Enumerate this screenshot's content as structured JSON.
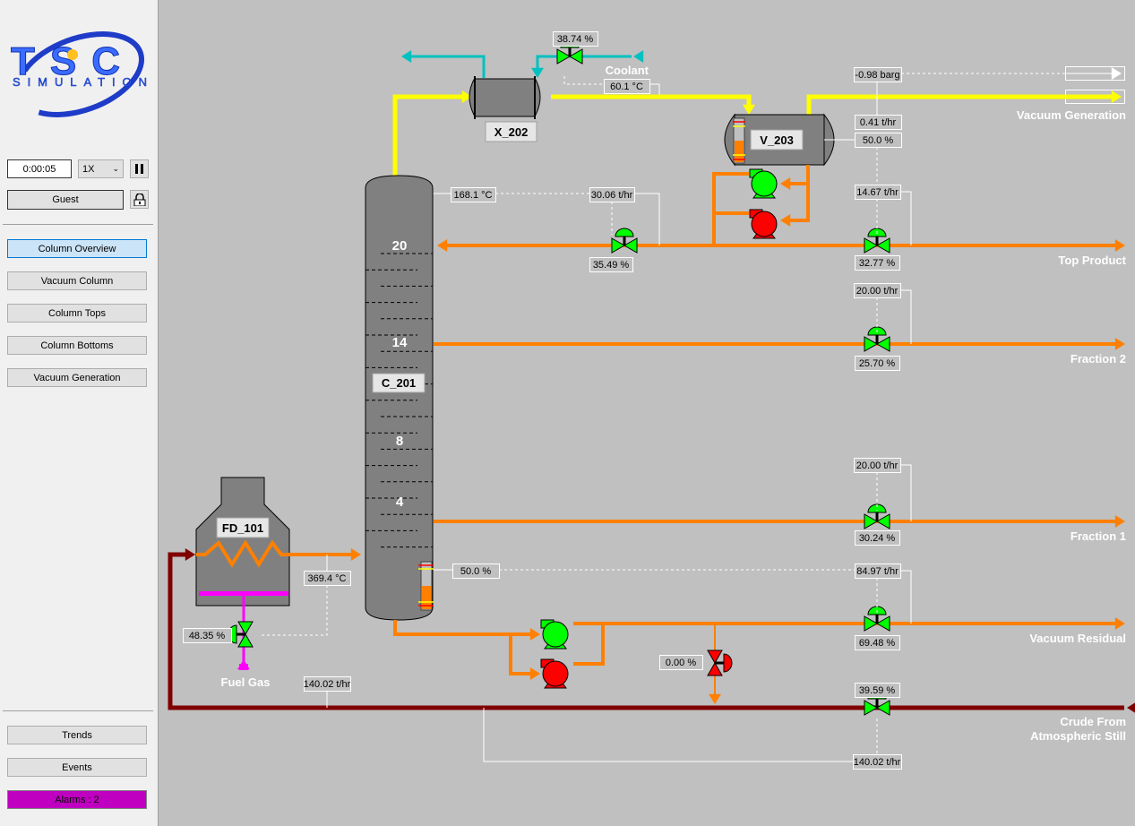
{
  "sidebar": {
    "logo_text": "TSC SIMULATION",
    "sim_time": "0:00:05",
    "speed": "1X",
    "user": "Guest",
    "nav": [
      "Column Overview",
      "Vacuum Column",
      "Column Tops",
      "Column Bottoms",
      "Vacuum Generation"
    ],
    "active_nav": "Column Overview",
    "bottom": {
      "trends": "Trends",
      "events": "Events",
      "alarms": "Alarms : 2"
    }
  },
  "colors": {
    "vapor": "#ffff00",
    "liquid": "#ff8000",
    "coolant": "#00c0c0",
    "crude": "#800000",
    "fuel_gas": "#ff00ff",
    "running": "#00ff00",
    "stopped": "#ff0000",
    "alarm": "#c000c0"
  },
  "equipment": {
    "exchanger": "X_202",
    "drum": "V_203",
    "column": "C_201",
    "furnace": "FD_101"
  },
  "trays": [
    "20",
    "14",
    "8",
    "4"
  ],
  "labels": {
    "coolant": "Coolant",
    "vacuum_generation": "Vacuum Generation",
    "top_product": "Top Product",
    "fraction2": "Fraction 2",
    "fraction1": "Fraction 1",
    "vacuum_residual": "Vacuum Residual",
    "crude1": "Crude From",
    "crude2": "Atmospheric Still",
    "fuel_gas": "Fuel  Gas"
  },
  "readouts": {
    "coolant_valve": "38.74 %",
    "cond_temp": "60.1 °C",
    "top_temp": "168.1 °C",
    "reflux_flow": "30.06 t/hr",
    "reflux_valve": "35.49 %",
    "drum_pressure": "-0.98 barg",
    "vent_flow": "0.41 t/hr",
    "drum_level": "50.0 %",
    "top_flow": "14.67 t/hr",
    "top_valve": "32.77 %",
    "f2_flow": "20.00 t/hr",
    "f2_valve": "25.70 %",
    "f1_flow": "20.00 t/hr",
    "f1_valve": "30.24 %",
    "res_flow": "84.97 t/hr",
    "res_valve": "69.48 %",
    "crude_valve": "39.59 %",
    "crude_flow": "140.02 t/hr",
    "bottom_level": "50.0 %",
    "furnace_temp": "369.4 °C",
    "fuel_valve": "48.35 %",
    "furnace_flow": "140.02 t/hr",
    "bypass_valve": "0.00 %"
  },
  "valves": {
    "coolant": "open",
    "reflux": "open",
    "top": "open",
    "f2": "open",
    "f1": "open",
    "residual": "open",
    "crude": "open",
    "fuel": "open",
    "bypass": "closed"
  },
  "pumps": {
    "drum_a": "running",
    "drum_b": "stopped",
    "bottom_a": "running",
    "bottom_b": "stopped"
  },
  "levels": {
    "drum": 0.5,
    "column_bottom": 0.5
  }
}
